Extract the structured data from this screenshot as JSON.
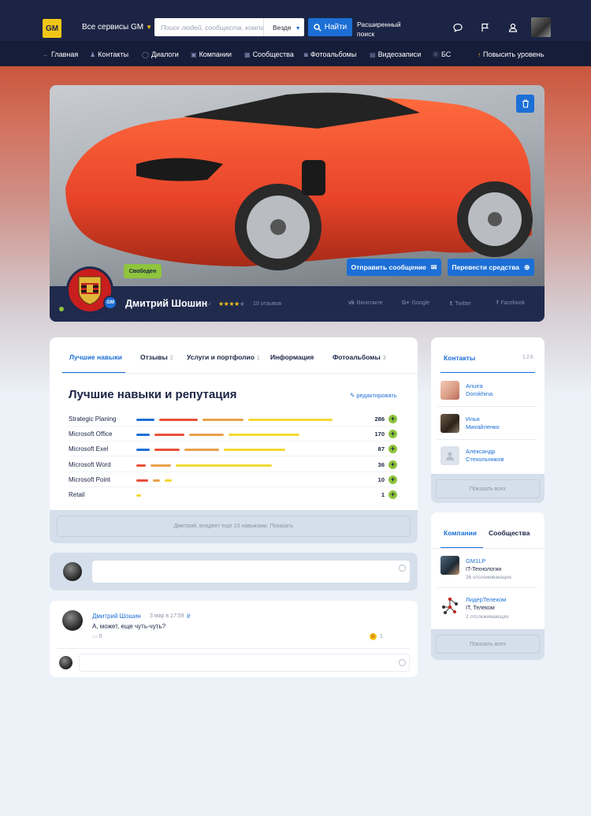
{
  "brand": {
    "logo_text": "GM",
    "services_label": "Все сервисы GM",
    "accent": "#1c6fd6",
    "dark": "#1b2444",
    "yellow": "#f2c617",
    "green": "#8fc43c"
  },
  "search": {
    "placeholder": "Поиск людей, сообществ, компаний, товаров",
    "scope": "Везде",
    "button": "Найти",
    "advanced": "Расширенный поиск"
  },
  "nav": {
    "items": [
      "Главная",
      "Контакты",
      "Диалоги",
      "Компании",
      "Сообщества",
      "Фотоальбомы",
      "Видеозаписи",
      "БС"
    ],
    "upgrade": "Повысить уровень"
  },
  "profile": {
    "name": "Дмитрий Шошин",
    "status": "Свободен",
    "rating": 4,
    "reviews": "10 отзывов",
    "badge": "GM",
    "send_message": "Отправить сообщение",
    "transfer": "Перевести средства",
    "socials": [
      "Вконтакте",
      "Google",
      "Twitter",
      "Facebook"
    ]
  },
  "tabs": [
    {
      "label": "Лучшие навыки",
      "count": ""
    },
    {
      "label": "Отзывы",
      "count": "2"
    },
    {
      "label": "Услуги и портфолио",
      "count": "1"
    },
    {
      "label": "Информация",
      "count": ""
    },
    {
      "label": "Фотоальбомы",
      "count": "3"
    }
  ],
  "skills": {
    "title": "Лучшие навыки и репутация",
    "edit": "редактировать",
    "items": [
      {
        "name": "Strategic Planing",
        "value": "286",
        "fill": [
          0.08,
          0.17,
          0.18,
          0.37
        ]
      },
      {
        "name": "Microsoft Office",
        "value": "170",
        "fill": [
          0.06,
          0.13,
          0.15,
          0.31
        ]
      },
      {
        "name": "Microsoft Exel",
        "value": "87",
        "fill": [
          0.06,
          0.11,
          0.15,
          0.27
        ]
      },
      {
        "name": "Microsoft Word",
        "value": "36",
        "fill": [
          0.04,
          0.09,
          0.42
        ]
      },
      {
        "name": "Microsoft Point",
        "value": "10",
        "fill": [
          0.05,
          0.03,
          0.03
        ]
      },
      {
        "name": "Retail",
        "value": "1",
        "fill": [
          0.02
        ]
      }
    ],
    "more": "Дмитрий, владеет еще 10 навыками. Показать"
  },
  "post": {
    "author": "Дмитрий Шошин",
    "date": "3 мар в 17:59",
    "hash": "#",
    "text": "А, может, еще чуть-чуть?",
    "comments": "0",
    "likes": "1"
  },
  "contacts": {
    "title": "Контакты",
    "count": "120",
    "show_all": "Показать всех",
    "items": [
      {
        "first": "Anuira",
        "last": "Dorokhina"
      },
      {
        "first": "Илья",
        "last": "Михайленко"
      },
      {
        "first": "Александр",
        "last": "Стекольников"
      }
    ]
  },
  "companies": {
    "tab_companies": "Компании",
    "tab_communities": "Сообщества",
    "show_all": "Показать всех",
    "items": [
      {
        "name": "GM1LP",
        "category": "IT-Технологии",
        "followers": "36 отслеживающих"
      },
      {
        "name": "ЛидерТелеком",
        "category": "IT, Телеком",
        "followers": "2 отслеживающих"
      }
    ]
  }
}
